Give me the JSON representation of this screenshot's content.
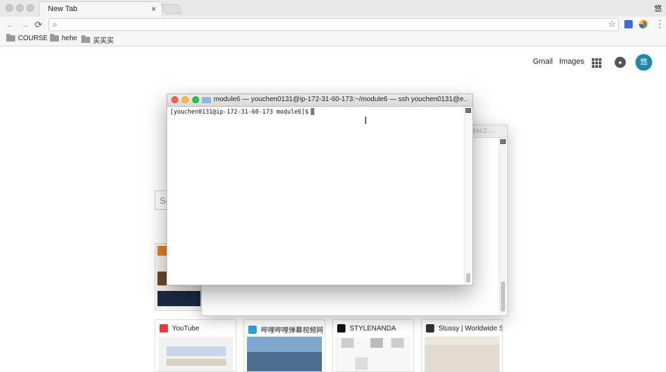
{
  "browser": {
    "tab_title": "New Tab",
    "tab_close": "×",
    "profile_char": "悠",
    "nav": {
      "back": "←",
      "forward": "→",
      "reload": "⟳"
    },
    "omnibox": {
      "search_icon": "⌕",
      "value": "",
      "star_icon": "☆"
    },
    "menu_icon": "⋮",
    "bookmarks": [
      "COURSE",
      "hehe",
      "买买买"
    ]
  },
  "google": {
    "links": [
      "Gmail",
      "Images"
    ],
    "avatar_text": "悠",
    "search_partial": "Se",
    "tiles": [
      {
        "title": "YouTube",
        "favicon_color": "#e53935"
      },
      {
        "title": "哔哩哔哩弹幕视频网",
        "favicon_color": "#29a3d9"
      },
      {
        "title": "STYLENANDA",
        "favicon_color": "#111111"
      },
      {
        "title": "Stussy | Worldwide S",
        "favicon_color": "#333333"
      }
    ]
  },
  "terminal_front": {
    "title": "module6 — youchen0131@ip-172-31-60-173:~/module6 — ssh youchen0131@e...",
    "prompt": "[youchen0131@ip-172-31-60-173 module6]$"
  },
  "terminal_back": {
    "title_fragment": "@ec2-..."
  }
}
